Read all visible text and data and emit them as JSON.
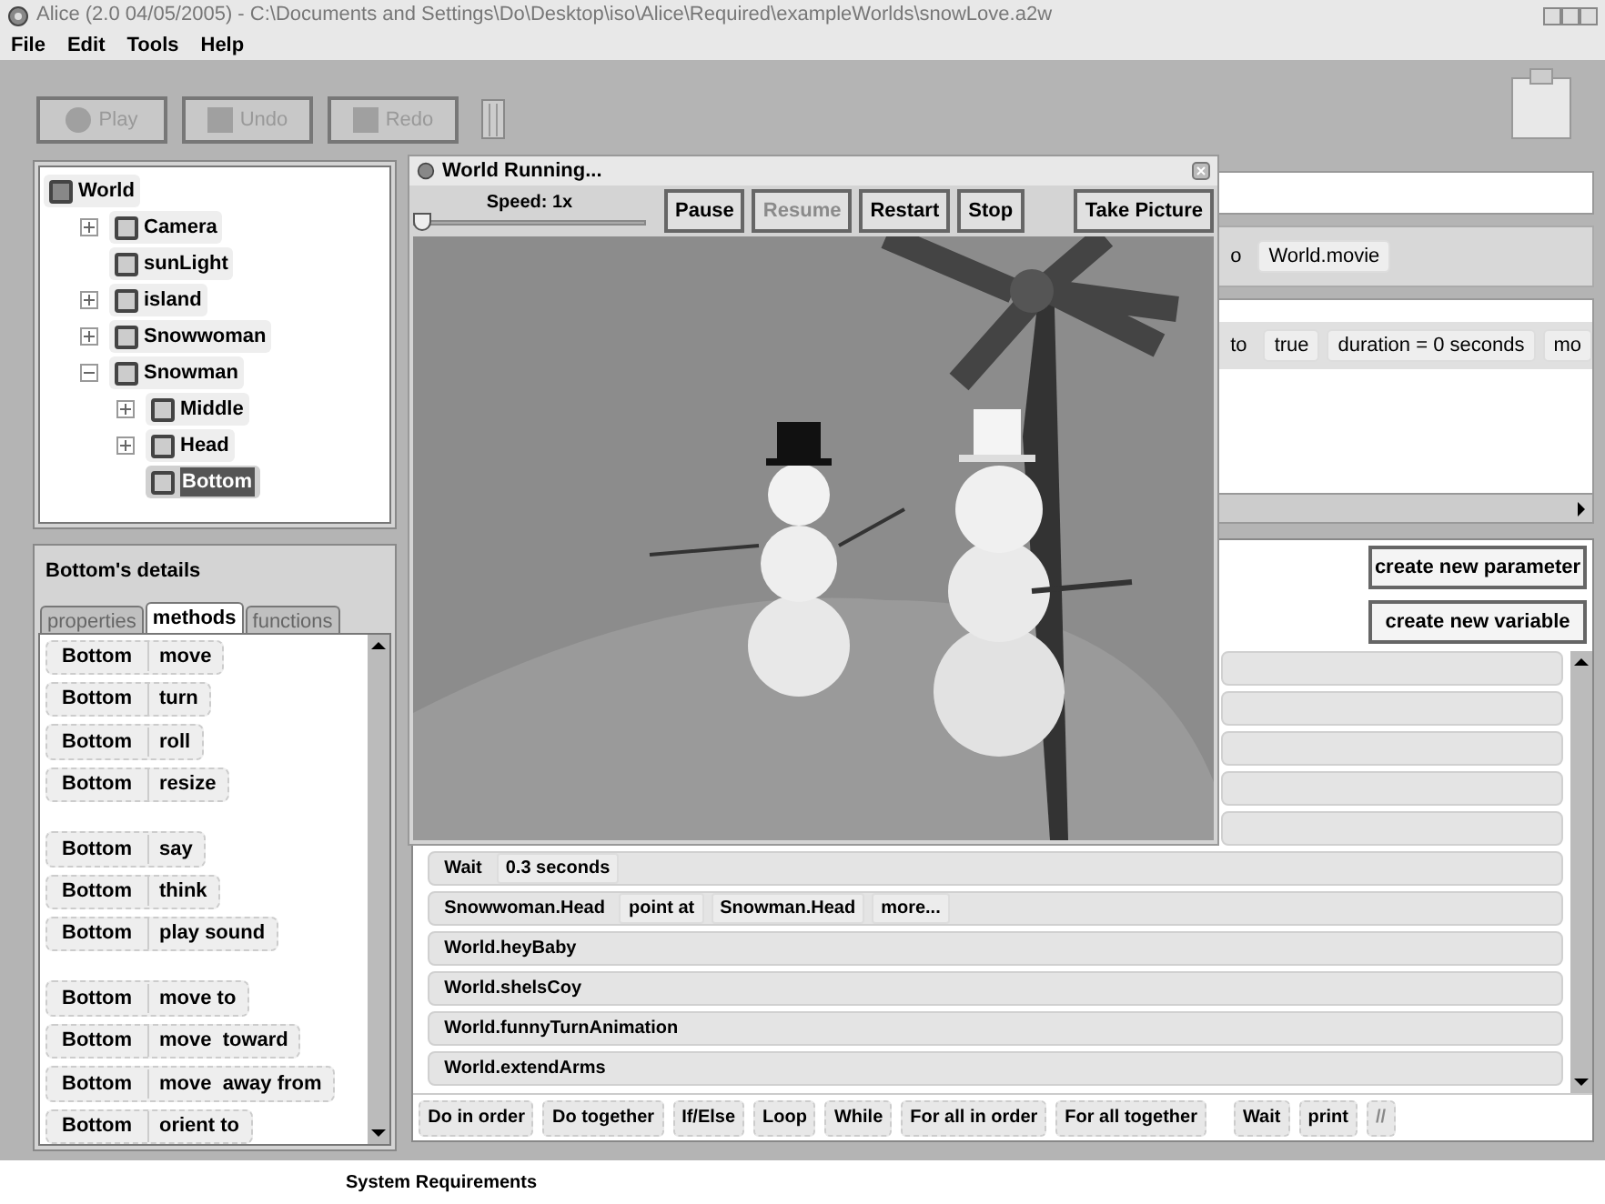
{
  "window": {
    "title": "Alice (2.0 04/05/2005) - C:\\Documents and Settings\\Do\\Desktop\\iso\\Alice\\Required\\exampleWorlds\\snowLove.a2w"
  },
  "menu": [
    "File",
    "Edit",
    "Tools",
    "Help"
  ],
  "toolbar": [
    {
      "label": "Play",
      "disabled": true
    },
    {
      "label": "Undo",
      "disabled": true
    },
    {
      "label": "Redo",
      "disabled": true
    }
  ],
  "object_tree": [
    {
      "label": "World",
      "selected": false,
      "children": [
        {
          "label": "Camera",
          "selected": false,
          "expanded": false
        },
        {
          "label": "sunLight",
          "selected": false
        },
        {
          "label": "island",
          "selected": false,
          "expanded": false
        },
        {
          "label": "Snowwoman",
          "selected": false,
          "expanded": false
        },
        {
          "label": "Snowman",
          "selected": false,
          "expanded": true,
          "children": [
            {
              "label": "Middle",
              "selected": false,
              "expanded": false
            },
            {
              "label": "Head",
              "selected": false,
              "expanded": false
            },
            {
              "label": "Bottom",
              "selected": true
            }
          ]
        }
      ]
    }
  ],
  "details": {
    "title": "Bottom's details",
    "tabs": [
      {
        "label": "properties",
        "selected": false
      },
      {
        "label": "methods",
        "selected": true
      },
      {
        "label": "functions",
        "selected": false
      }
    ],
    "method_groups": [
      [
        {
          "object": "Bottom",
          "method": "move"
        },
        {
          "object": "Bottom",
          "method": "turn"
        },
        {
          "object": "Bottom",
          "method": "roll"
        },
        {
          "object": "Bottom",
          "method": "resize"
        }
      ],
      [
        {
          "object": "Bottom",
          "method": "say"
        },
        {
          "object": "Bottom",
          "method": "think"
        },
        {
          "object": "Bottom",
          "method": "play sound"
        }
      ],
      [
        {
          "object": "Bottom",
          "method": "move to"
        },
        {
          "object": "Bottom",
          "method": "move  toward"
        },
        {
          "object": "Bottom",
          "method": "move  away from"
        },
        {
          "object": "Bottom",
          "method": "orient to"
        }
      ]
    ]
  },
  "editor": {
    "top_rows": [
      [
        "o",
        "World.movie"
      ],
      [
        "to",
        "true",
        "duration = 0 seconds",
        "mo"
      ]
    ],
    "buttons": [
      "create new parameter",
      "create new variable"
    ],
    "statements": [
      [
        "Wait",
        "0.3 seconds"
      ],
      [
        "Snowwoman.Head",
        "point at",
        "Snowman.Head",
        "more..."
      ],
      [
        "World.heyBaby"
      ],
      [
        "World.shelsCoy"
      ],
      [
        "World.funnyTurnAnimation"
      ],
      [
        "World.extendArms"
      ]
    ],
    "control_buttons": [
      {
        "label": "Do in order",
        "disabled": false
      },
      {
        "label": "Do together",
        "disabled": false
      },
      {
        "label": "If/Else",
        "disabled": false
      },
      {
        "label": "Loop",
        "disabled": false
      },
      {
        "label": "While",
        "disabled": false
      },
      {
        "label": "For all in order",
        "disabled": false
      },
      {
        "label": "For all together",
        "disabled": false
      },
      {
        "label": "Wait",
        "disabled": false
      },
      {
        "label": "print",
        "disabled": false
      },
      {
        "label": "//",
        "disabled": true
      }
    ]
  },
  "running_window": {
    "title": "World Running...",
    "speed_label": "Speed: 1x",
    "speed": {
      "level": 0
    },
    "buttons": [
      {
        "label": "Pause",
        "disabled": false
      },
      {
        "label": "Resume",
        "disabled": true
      },
      {
        "label": "Restart",
        "disabled": false
      },
      {
        "label": "Stop",
        "disabled": false
      },
      {
        "label": "Take Picture",
        "disabled": false
      }
    ]
  },
  "status_bar": {
    "text": "System Requirements"
  }
}
